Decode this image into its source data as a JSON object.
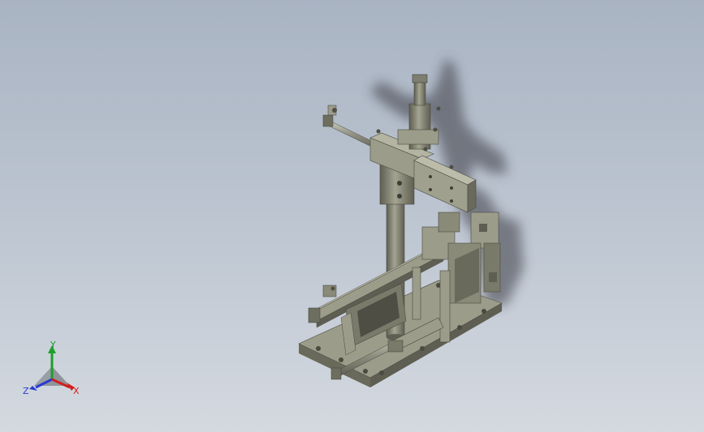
{
  "viewport": {
    "background_top": "#a9b4c3",
    "background_bottom": "#d4d9e0"
  },
  "model": {
    "body_color": "#8a8a78",
    "body_dark": "#5e5e52",
    "body_light": "#b4b4a2",
    "shadow_color": "#3a3a42"
  },
  "triad": {
    "x_label": "X",
    "y_label": "Y",
    "z_label": "Z",
    "x_color": "#d21e1e",
    "y_color": "#1ea02a",
    "z_color": "#2a3ad0"
  }
}
